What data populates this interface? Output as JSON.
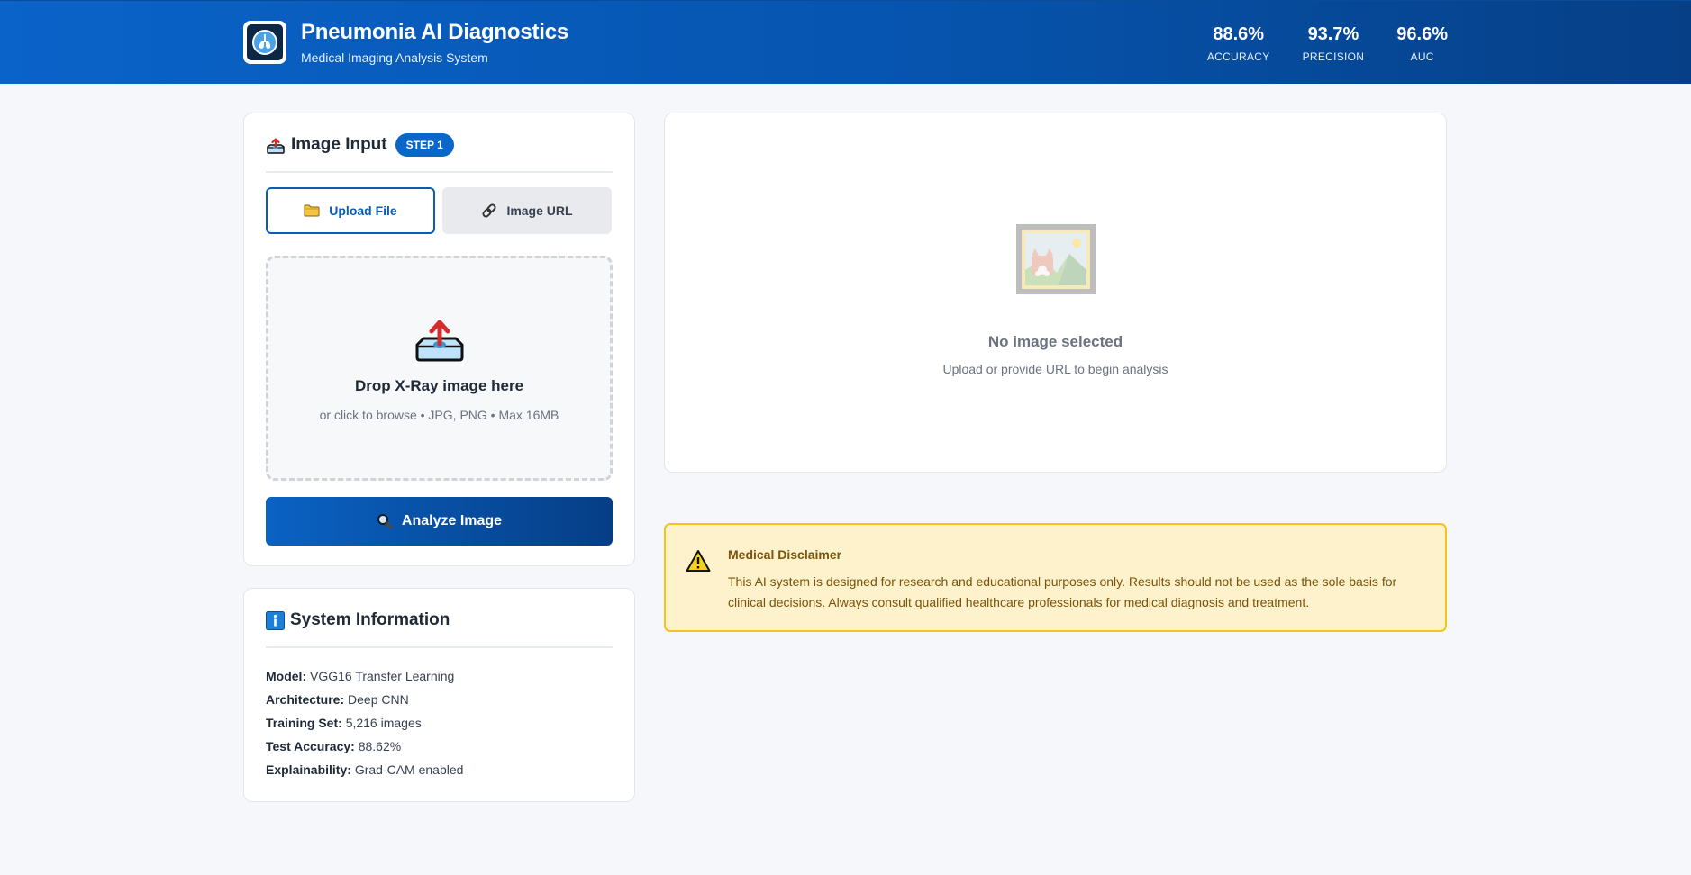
{
  "header": {
    "title": "Pneumonia AI Diagnostics",
    "subtitle": "Medical Imaging Analysis System",
    "stats": [
      {
        "value": "88.6%",
        "label": "ACCURACY"
      },
      {
        "value": "93.7%",
        "label": "PRECISION"
      },
      {
        "value": "96.6%",
        "label": "AUC"
      }
    ]
  },
  "input_card": {
    "title": "Image Input",
    "step_badge": "STEP 1",
    "tabs": [
      {
        "label": "Upload File",
        "icon": "folder-icon",
        "active": true
      },
      {
        "label": "Image URL",
        "icon": "link-icon",
        "active": false
      }
    ],
    "dropzone": {
      "title": "Drop X-Ray image here",
      "subtitle": "or click to browse • JPG, PNG • Max 16MB"
    },
    "analyze_button": "Analyze Image"
  },
  "system_info": {
    "title": "System Information",
    "rows": [
      {
        "label": "Model:",
        "value": "VGG16 Transfer Learning"
      },
      {
        "label": "Architecture:",
        "value": "Deep CNN"
      },
      {
        "label": "Training Set:",
        "value": "5,216 images"
      },
      {
        "label": "Test Accuracy:",
        "value": "88.62%"
      },
      {
        "label": "Explainability:",
        "value": "Grad-CAM enabled"
      }
    ]
  },
  "preview": {
    "title": "No image selected",
    "subtitle": "Upload or provide URL to begin analysis"
  },
  "disclaimer": {
    "title": "Medical Disclaimer",
    "body": "This AI system is designed for research and educational purposes only. Results should not be used as the sole basis for clinical decisions. Always consult qualified healthcare professionals for medical diagnosis and treatment."
  },
  "colors": {
    "header_start": "#0a63c9",
    "header_end": "#063f86",
    "accent": "#0a66c8",
    "warning_bg": "#fdf2cc",
    "warning_border": "#f4c419"
  }
}
